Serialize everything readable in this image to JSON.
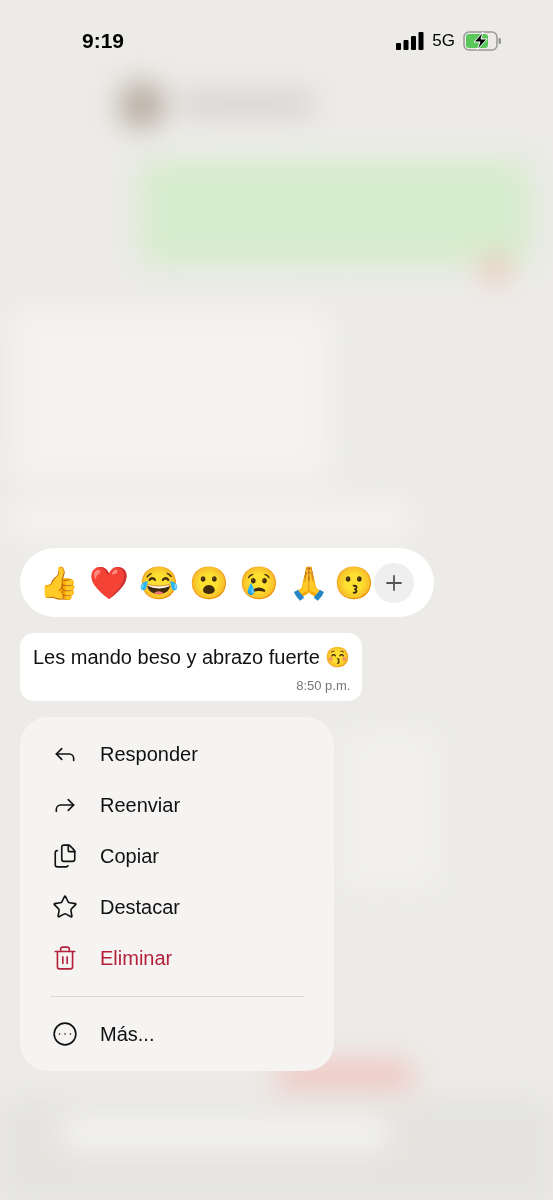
{
  "status_bar": {
    "time": "9:19",
    "network": "5G"
  },
  "reactions": {
    "emojis": [
      "👍",
      "❤️",
      "😂",
      "😮",
      "😢",
      "🙏",
      "😗"
    ]
  },
  "message": {
    "text": "Les mando beso y abrazo fuerte 😚",
    "time": "8:50 p.m."
  },
  "menu": {
    "items": [
      {
        "label": "Responder",
        "kind": "reply",
        "destructive": false
      },
      {
        "label": "Reenviar",
        "kind": "forward",
        "destructive": false
      },
      {
        "label": "Copiar",
        "kind": "copy",
        "destructive": false
      },
      {
        "label": "Destacar",
        "kind": "star",
        "destructive": false
      },
      {
        "label": "Eliminar",
        "kind": "delete",
        "destructive": true
      }
    ],
    "more_item": {
      "label": "Más...",
      "kind": "more",
      "destructive": false
    }
  }
}
